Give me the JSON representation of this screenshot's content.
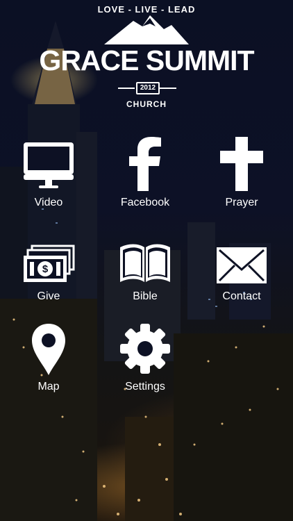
{
  "header": {
    "tagline": "LOVE - LIVE - LEAD",
    "church_name": "GRACE SUMMIT",
    "year": "2012",
    "subtitle": "CHURCH"
  },
  "menu": [
    {
      "label": "Video",
      "icon": "monitor-icon"
    },
    {
      "label": "Facebook",
      "icon": "facebook-icon"
    },
    {
      "label": "Prayer",
      "icon": "cross-icon"
    },
    {
      "label": "Give",
      "icon": "money-icon"
    },
    {
      "label": "Bible",
      "icon": "book-icon"
    },
    {
      "label": "Contact",
      "icon": "envelope-icon"
    },
    {
      "label": "Map",
      "icon": "map-pin-icon"
    },
    {
      "label": "Settings",
      "icon": "gear-icon"
    }
  ]
}
